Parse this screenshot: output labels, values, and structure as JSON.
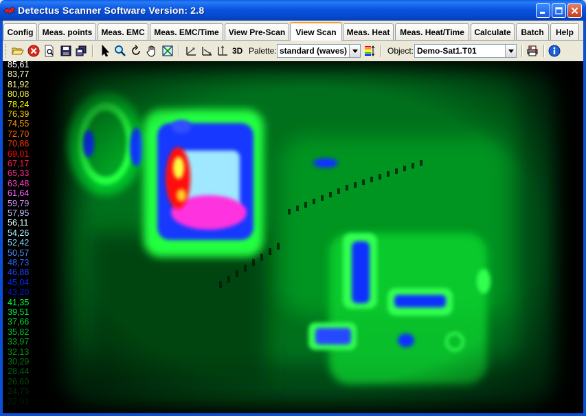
{
  "window": {
    "title": "Detectus Scanner Software Version: 2.8",
    "icon": "app-icon",
    "controls": [
      "minimize",
      "maximize",
      "close"
    ]
  },
  "tabs": [
    {
      "label": "Config",
      "active": false
    },
    {
      "label": "Meas. points",
      "active": false
    },
    {
      "label": "Meas. EMC",
      "active": false
    },
    {
      "label": "Meas. EMC/Time",
      "active": false
    },
    {
      "label": "View Pre-Scan",
      "active": false
    },
    {
      "label": "View Scan",
      "active": true
    },
    {
      "label": "Meas. Heat",
      "active": false
    },
    {
      "label": "Meas. Heat/Time",
      "active": false
    },
    {
      "label": "Calculate",
      "active": false
    },
    {
      "label": "Batch",
      "active": false
    },
    {
      "label": "Help",
      "active": false
    }
  ],
  "toolbar": {
    "buttons": [
      "open-folder-icon",
      "stop-icon",
      "preview-icon",
      "save-icon",
      "copy-icon",
      "pointer-icon",
      "zoom-icon",
      "rotate-icon",
      "pan-hand-icon",
      "fit-icon",
      "axis-x-icon",
      "axis-y-icon",
      "axis-z-icon"
    ],
    "view_3d_label": "3D",
    "palette_label": "Palette:",
    "palette_value": "standard (waves)",
    "object_label": "Object:",
    "object_value": "Demo-Sat1.T01"
  },
  "legend": {
    "values": [
      "85,61",
      "83,77",
      "81,92",
      "80,08",
      "78,24",
      "76,39",
      "74,55",
      "72,70",
      "70,86",
      "69,01",
      "67,17",
      "65,33",
      "63,48",
      "61,64",
      "59,79",
      "57,95",
      "56,11",
      "54,26",
      "52,42",
      "50,57",
      "48,73",
      "46,88",
      "45,04",
      "43,20",
      "41,35",
      "39,51",
      "37,66",
      "35,82",
      "33,97",
      "32,13",
      "30,29",
      "28,44",
      "26,60",
      "24,75",
      "22,91"
    ],
    "colors": [
      "#ffffff",
      "#ffffc8",
      "#ffff90",
      "#ffff40",
      "#ffff00",
      "#ffcc00",
      "#ff9900",
      "#ff6600",
      "#ff3300",
      "#ff0000",
      "#ff1450",
      "#ff2a8c",
      "#ff40c0",
      "#ff60ff",
      "#d890ff",
      "#c8c8ff",
      "#d8ffff",
      "#b0f0ff",
      "#80d8ff",
      "#5090ff",
      "#3060ff",
      "#2040ff",
      "#0028ff",
      "#0018d8",
      "#00ff40",
      "#00ee30",
      "#00d828",
      "#00c020",
      "#00a818",
      "#009010",
      "#007810",
      "#006010",
      "#004808",
      "#003008",
      "#002004"
    ]
  },
  "heatmap": {
    "colors": {
      "background": "#000000",
      "low": "#003a08",
      "mid": "#00a020",
      "bright": "#20ff40",
      "cyan": "#a0ffff",
      "blue": "#1030ff",
      "magenta": "#ff30e0",
      "red": "#ff1010",
      "yellow": "#ffff40"
    }
  }
}
